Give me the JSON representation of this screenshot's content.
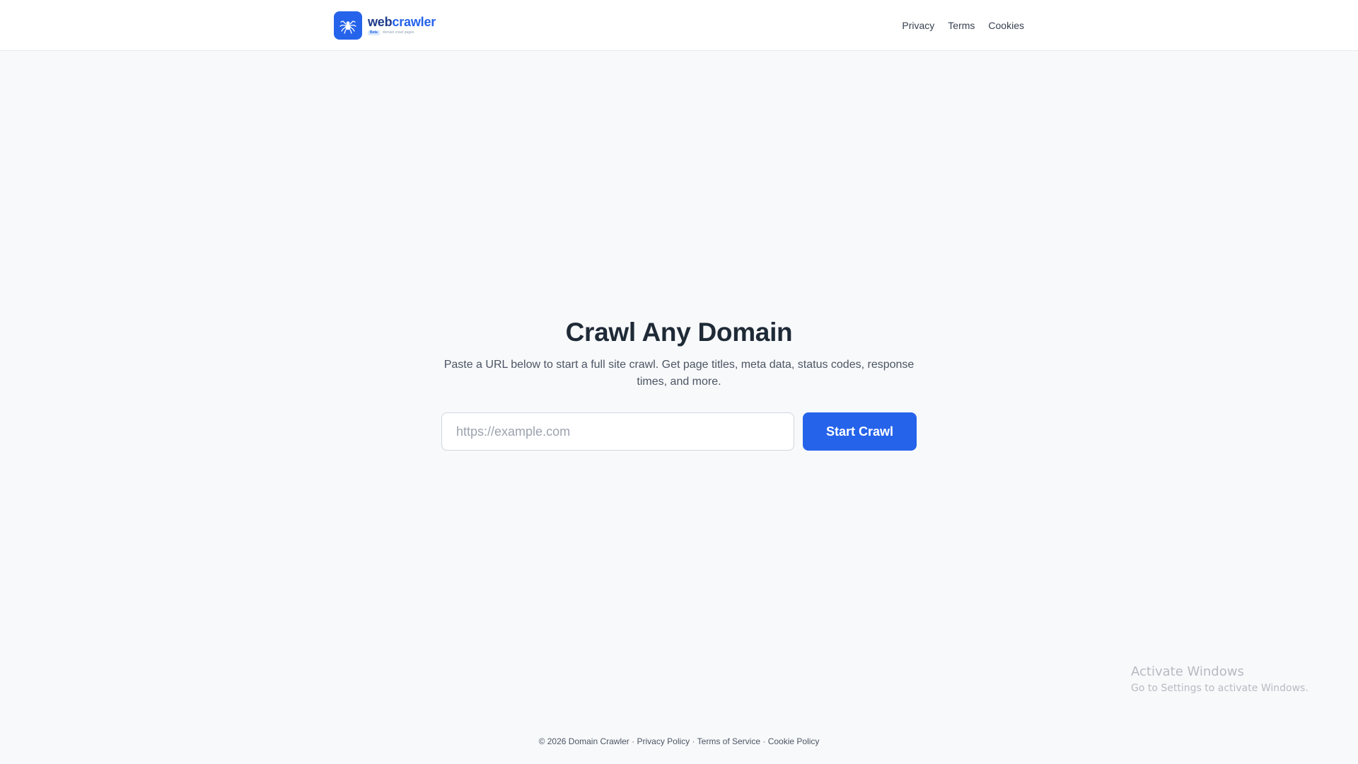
{
  "header": {
    "brand": {
      "name_part1": "web",
      "name_part2": "crawler",
      "pill": "Beta",
      "tagline": "domain crawl pages",
      "logo_icon": "spider-icon"
    },
    "nav": [
      {
        "label": "Privacy"
      },
      {
        "label": "Terms"
      },
      {
        "label": "Cookies"
      }
    ]
  },
  "hero": {
    "title": "Crawl Any Domain",
    "description": "Paste a URL below to start a full site crawl. Get page titles, meta data, status codes, response times, and more."
  },
  "form": {
    "url_placeholder": "https://example.com",
    "url_value": "",
    "submit_label": "Start Crawl"
  },
  "watermark": {
    "title": "Activate Windows",
    "subtitle": "Go to Settings to activate Windows."
  },
  "footer": {
    "copyright": "© 2026 Domain Crawler",
    "separator": "·",
    "links": [
      {
        "label": "Privacy Policy"
      },
      {
        "label": "Terms of Service"
      },
      {
        "label": "Cookie Policy"
      }
    ]
  },
  "colors": {
    "accent": "#2563eb",
    "background": "#f8f9fb",
    "header_bg": "#ffffff",
    "text_dark": "#1f2a37"
  }
}
